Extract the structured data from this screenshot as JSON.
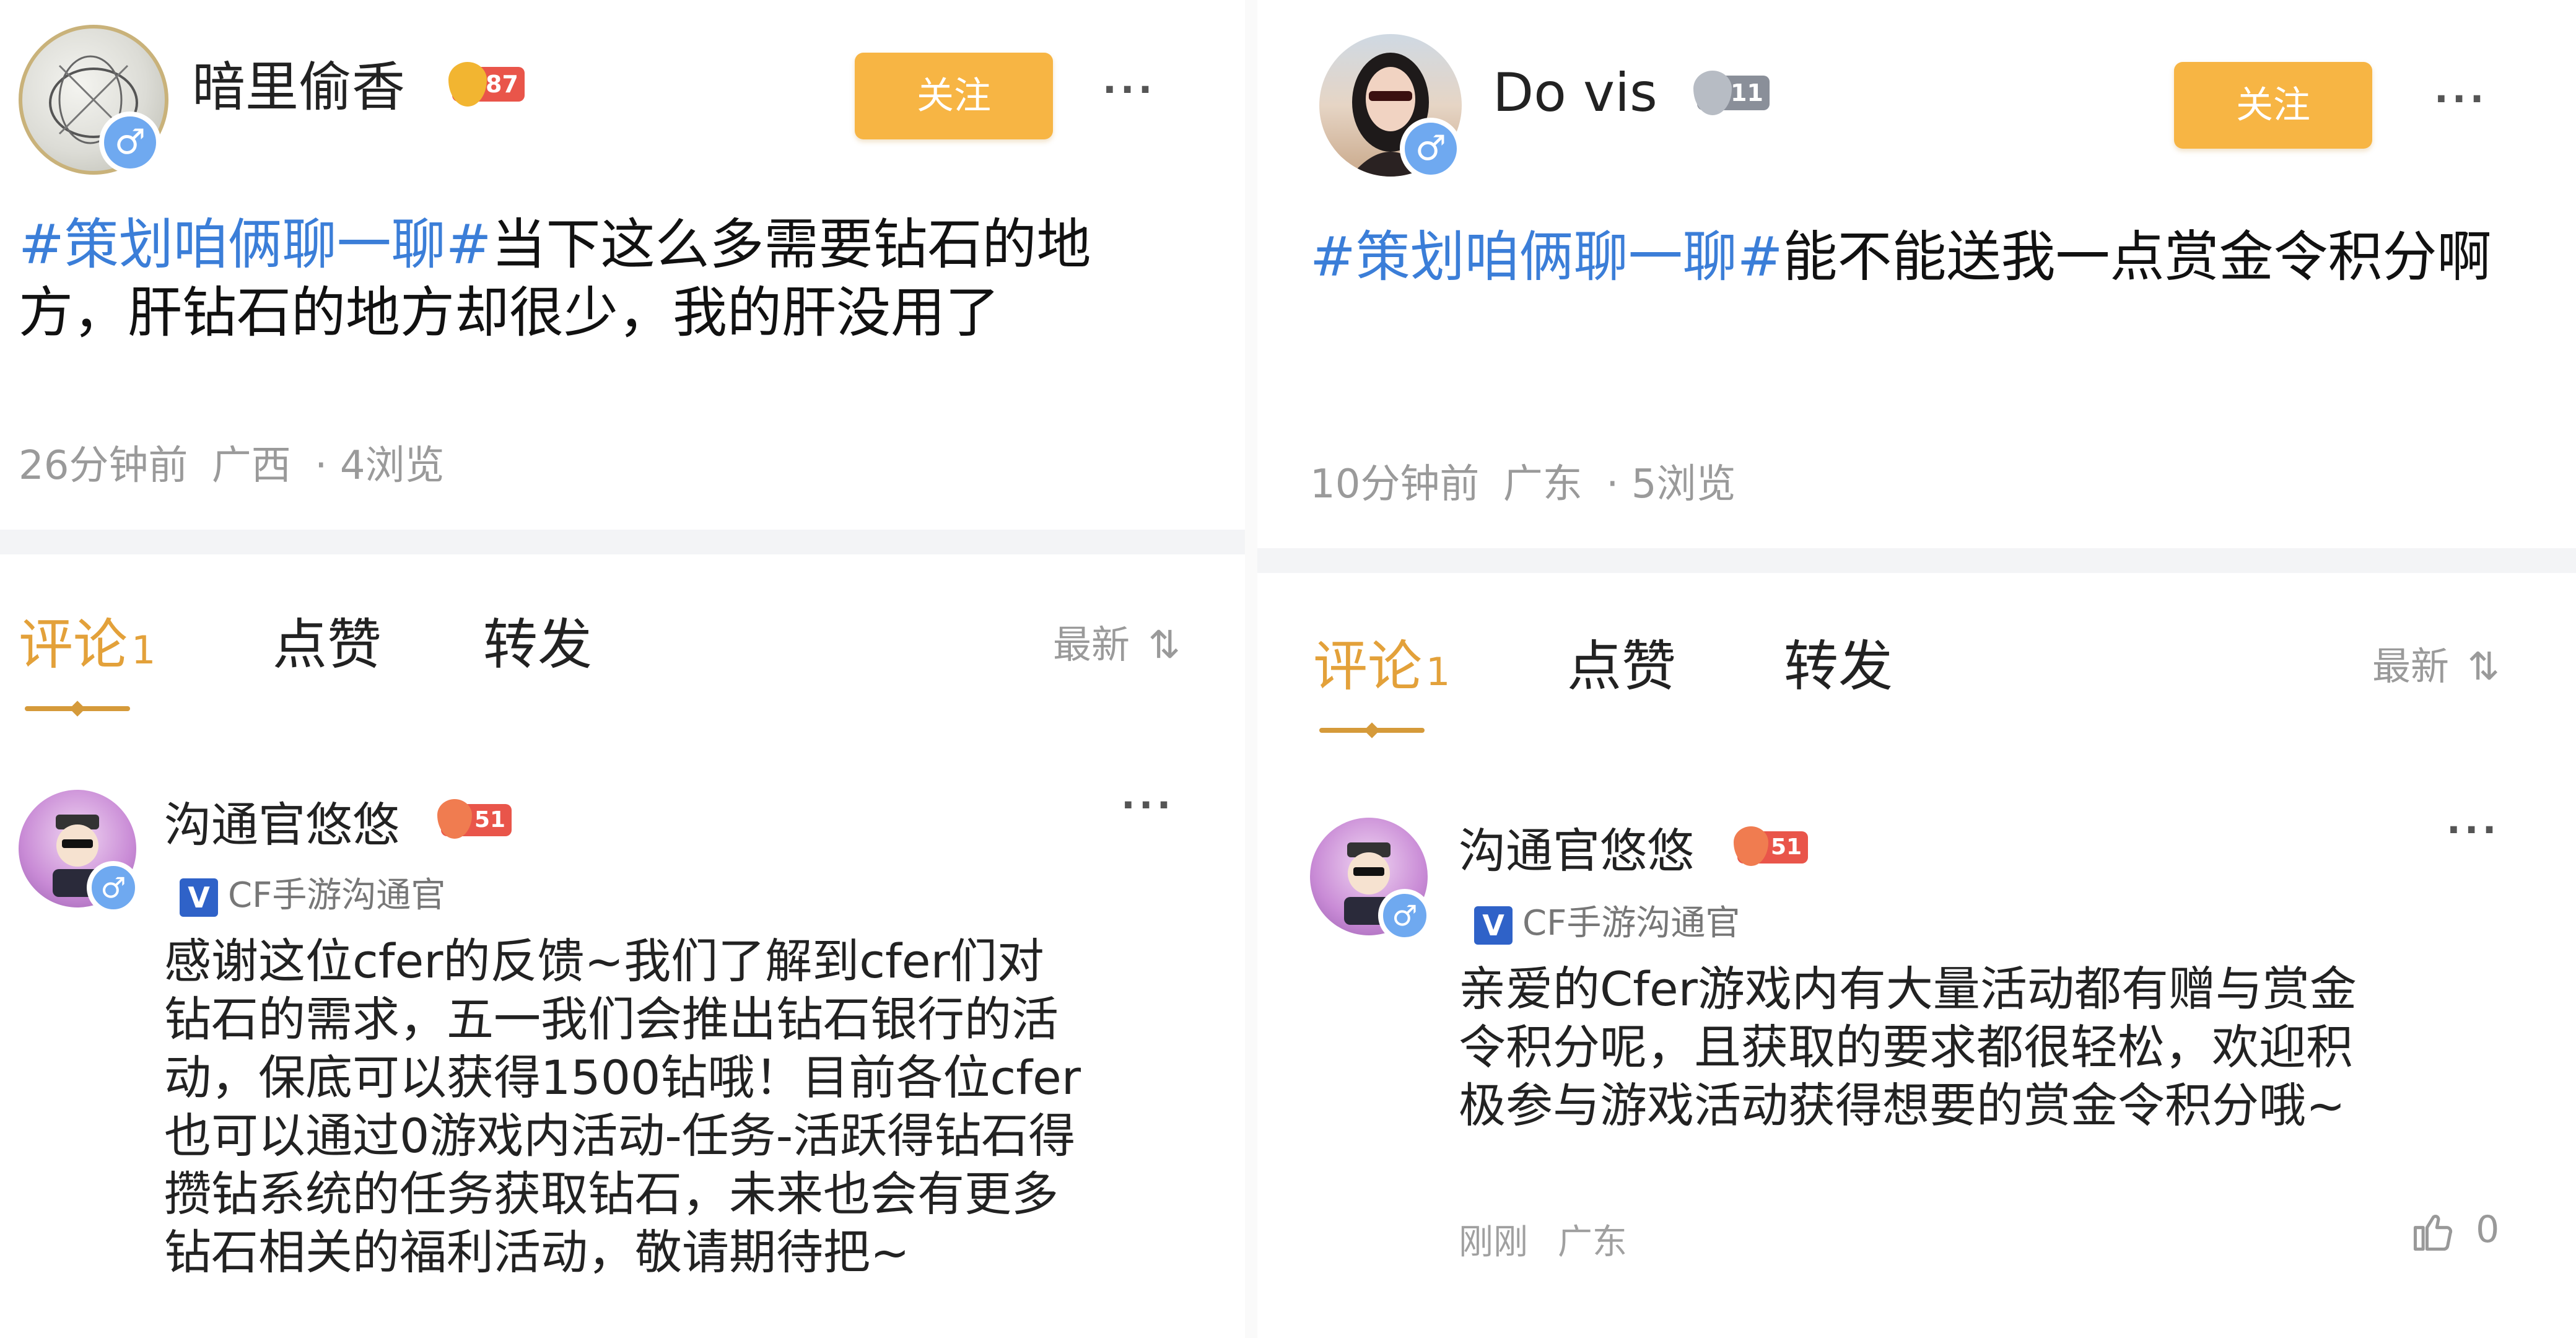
{
  "left": {
    "author": {
      "name": "暗里偷香",
      "level": "87",
      "follow_label": "关注",
      "more_label": "···"
    },
    "post": {
      "tag": "#策划咱俩聊一聊#",
      "text": "当下这么多需要钻石的地方，肝钻石的地方却很少，我的肝没用了",
      "time": "26分钟前",
      "location": "广西",
      "views": "· 4浏览"
    },
    "tabs": {
      "comments": "评论",
      "comments_count": "1",
      "likes": "点赞",
      "reposts": "转发",
      "sort": "最新"
    },
    "comment": {
      "name": "沟通官悠悠",
      "level": "51",
      "badge_mark": "V",
      "badge": "CF手游沟通官",
      "more_label": "···",
      "text": "感谢这位cfer的反馈~我们了解到cfer们对钻石的需求，五一我们会推出钻石银行的活动，保底可以获得1500钻哦！目前各位cfer也可以通过0游戏内活动-任务-活跃得钻石得攒钻系统的任务获取钻石，未来也会有更多钻石相关的福利活动，敬请期待把~"
    }
  },
  "right": {
    "author": {
      "name": "Do vis",
      "level": "11",
      "follow_label": "关注",
      "more_label": "···"
    },
    "post": {
      "tag": "#策划咱俩聊一聊#",
      "text": "能不能送我一点赏金令积分啊",
      "time": "10分钟前",
      "location": "广东",
      "views": "· 5浏览"
    },
    "tabs": {
      "comments": "评论",
      "comments_count": "1",
      "likes": "点赞",
      "reposts": "转发",
      "sort": "最新"
    },
    "comment": {
      "name": "沟通官悠悠",
      "level": "51",
      "badge_mark": "V",
      "badge": "CF手游沟通官",
      "more_label": "···",
      "text": "亲爱的Cfer游戏内有大量活动都有赠与赏金令积分呢，且获取的要求都很轻松，欢迎积极参与游戏活动获得想要的赏金令积分哦~",
      "time": "刚刚",
      "location": "广东",
      "likes": "0"
    }
  },
  "icons": {
    "gender": "male-icon",
    "sort": "sort-icon",
    "like": "thumbs-up-icon"
  },
  "colors": {
    "accent": "#f7b544",
    "tag": "#3b7ed8",
    "active_tab": "#e3a13a",
    "meta": "#9a9a9a",
    "level_red": "#e9554a",
    "level_gray": "#8a8f99"
  }
}
